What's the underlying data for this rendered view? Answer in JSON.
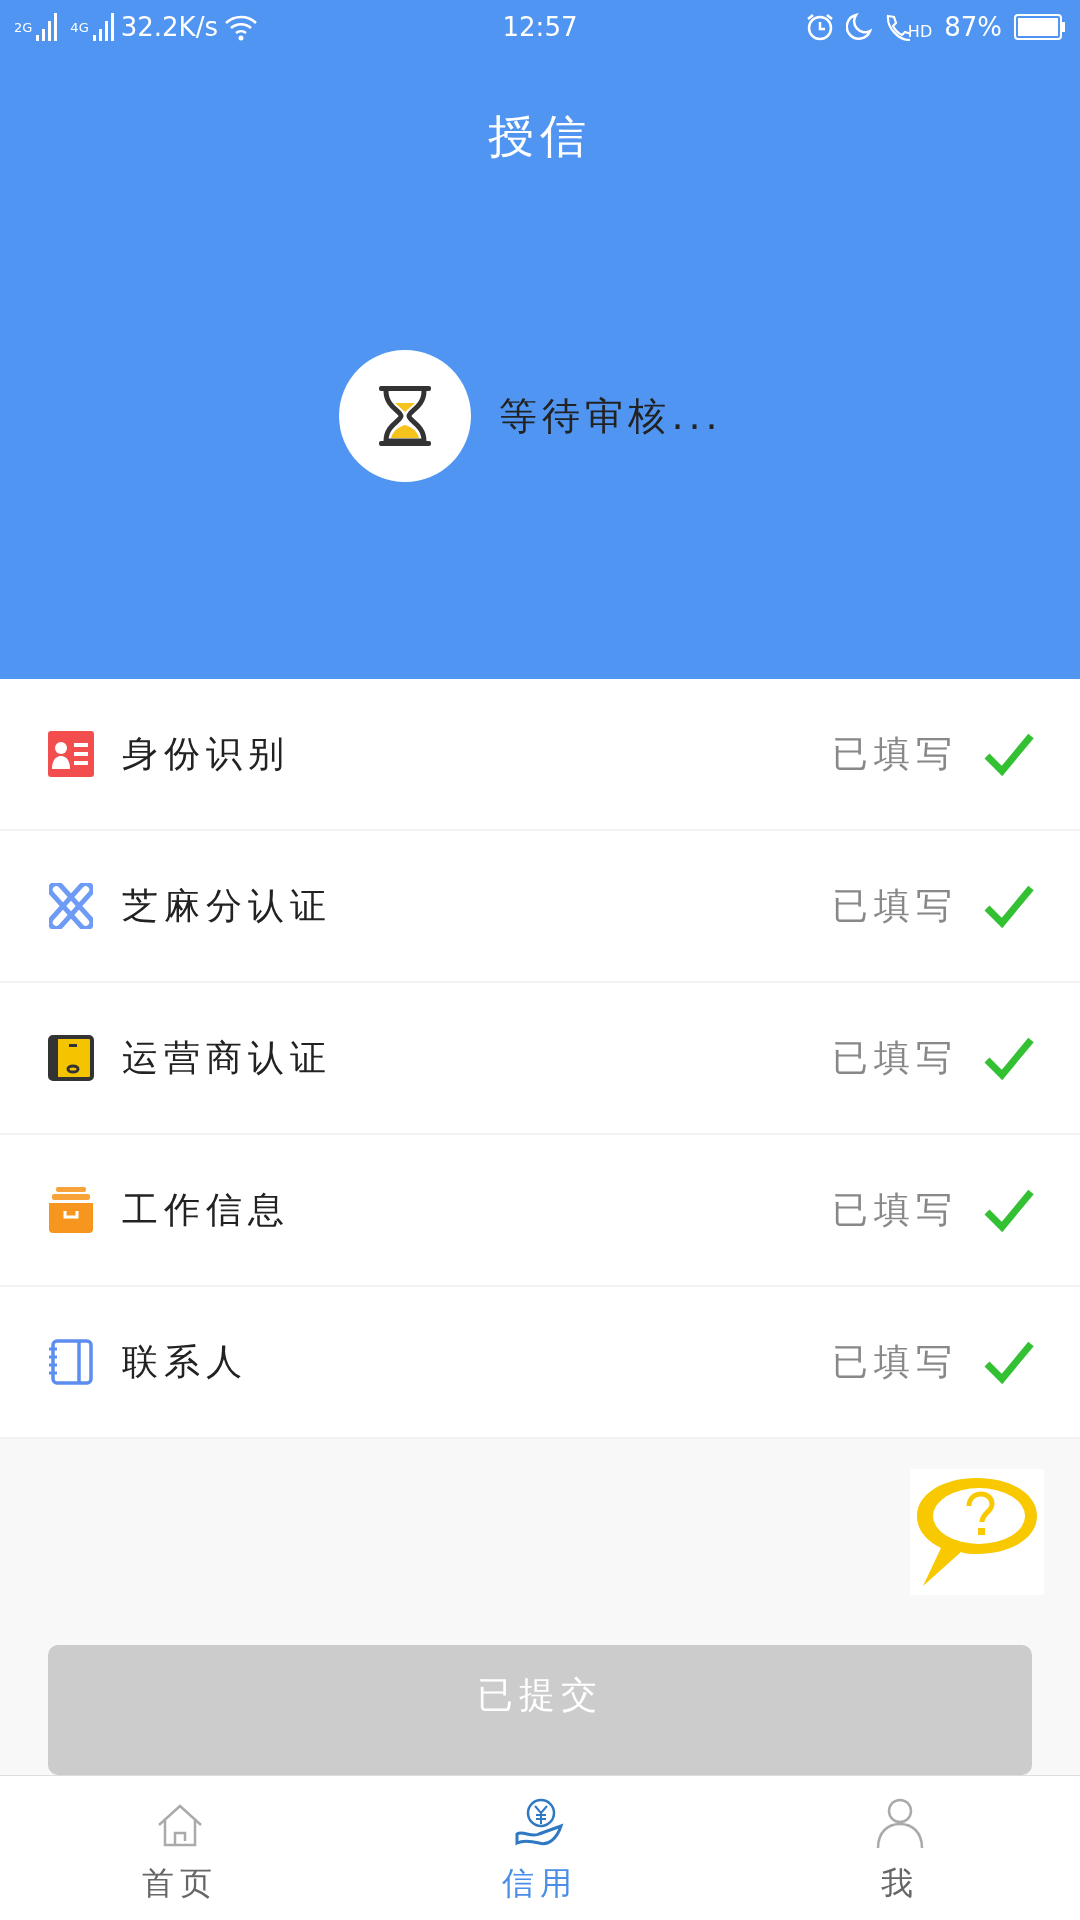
{
  "status_bar": {
    "sim1": "2G",
    "sim2": "4G",
    "speed": "32.2K/s",
    "time": "12:57",
    "call_label": "HD",
    "battery": "87%"
  },
  "header": {
    "title": "授信",
    "status": "等待审核..."
  },
  "items": [
    {
      "kind": "id",
      "label": "身份识别",
      "status": "已填写",
      "done": true
    },
    {
      "kind": "sesame",
      "label": "芝麻分认证",
      "status": "已填写",
      "done": true
    },
    {
      "kind": "carrier",
      "label": "运营商认证",
      "status": "已填写",
      "done": true
    },
    {
      "kind": "work",
      "label": "工作信息",
      "status": "已填写",
      "done": true
    },
    {
      "kind": "contacts",
      "label": "联系人",
      "status": "已填写",
      "done": true
    }
  ],
  "submit_button": {
    "label": "已提交",
    "disabled": true
  },
  "nav": [
    {
      "kind": "home",
      "label": "首页",
      "selected": false
    },
    {
      "kind": "credit",
      "label": "信用",
      "selected": true
    },
    {
      "kind": "me",
      "label": "我",
      "selected": false
    }
  ]
}
